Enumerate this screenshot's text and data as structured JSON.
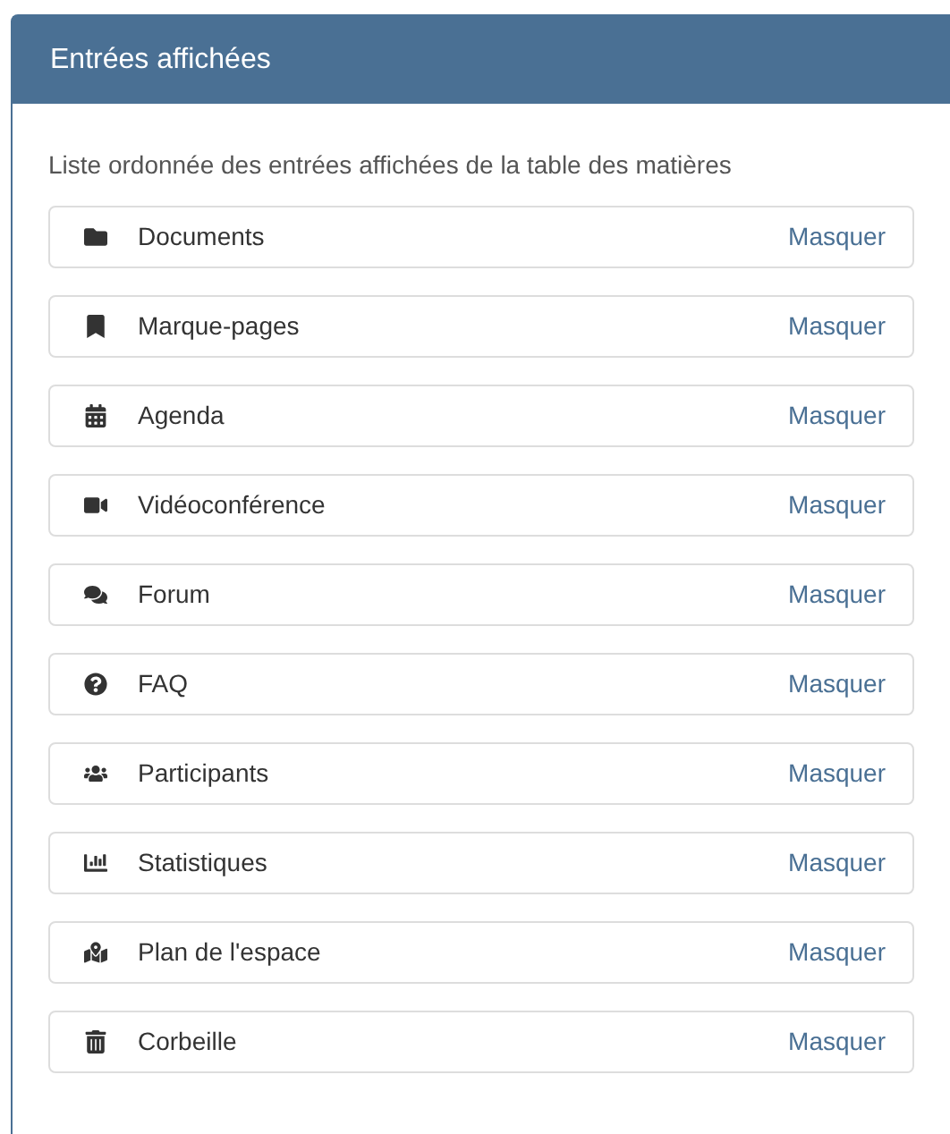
{
  "panel": {
    "title": "Entrées affichées",
    "description": "Liste ordonnée des entrées affichées de la table des matières",
    "entries": [
      {
        "kind": "folder",
        "label": "Documents",
        "action": "Masquer"
      },
      {
        "kind": "bookmark",
        "label": "Marque-pages",
        "action": "Masquer"
      },
      {
        "kind": "calendar",
        "label": "Agenda",
        "action": "Masquer"
      },
      {
        "kind": "video",
        "label": "Vidéoconférence",
        "action": "Masquer"
      },
      {
        "kind": "comments",
        "label": "Forum",
        "action": "Masquer"
      },
      {
        "kind": "question",
        "label": "FAQ",
        "action": "Masquer"
      },
      {
        "kind": "users",
        "label": "Participants",
        "action": "Masquer"
      },
      {
        "kind": "chart",
        "label": "Statistiques",
        "action": "Masquer"
      },
      {
        "kind": "map",
        "label": "Plan de l'espace",
        "action": "Masquer"
      },
      {
        "kind": "trash",
        "label": "Corbeille",
        "action": "Masquer"
      }
    ]
  }
}
